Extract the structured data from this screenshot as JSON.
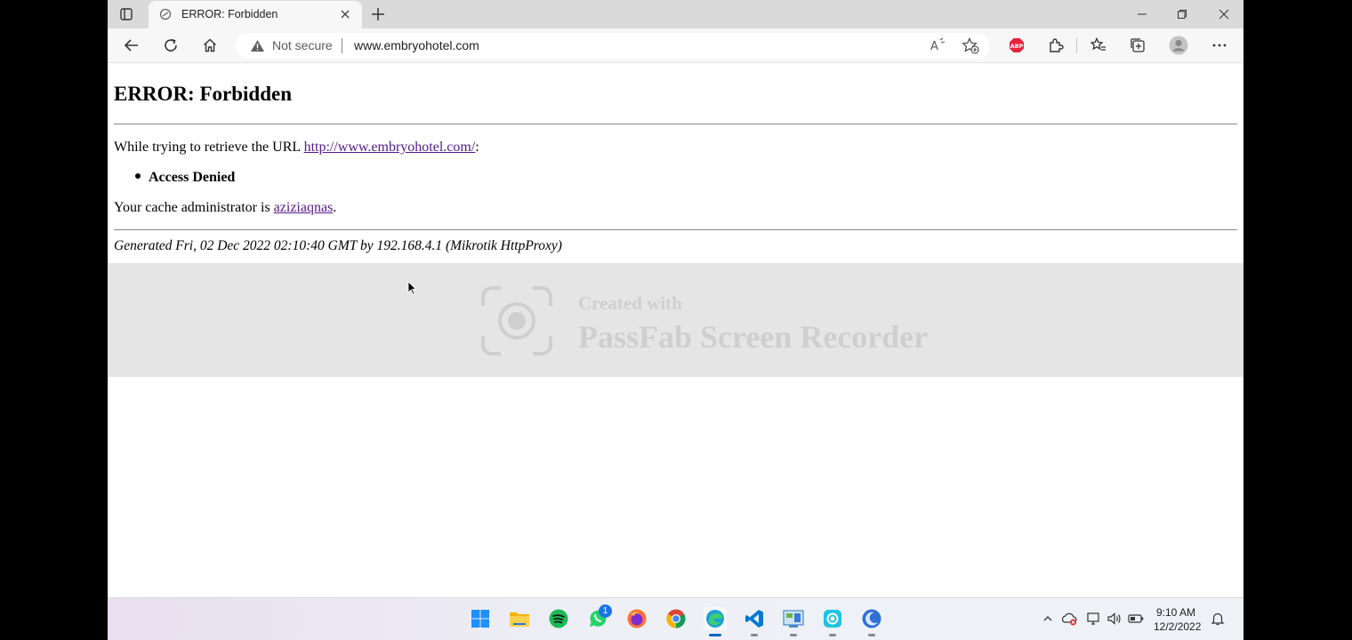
{
  "browser": {
    "tab": {
      "title": "ERROR: Forbidden"
    },
    "address": {
      "security": "Not secure",
      "url": "www.embryohotel.com"
    }
  },
  "page": {
    "heading": "ERROR: Forbidden",
    "line1_prefix": "While trying to retrieve the URL ",
    "line1_link": "http://www.embryohotel.com/",
    "line1_suffix": ":",
    "bullet": "Access Denied",
    "admin_prefix": "Your cache administrator is ",
    "admin_link": "aziziaqnas",
    "admin_suffix": ".",
    "footer": "Generated Fri, 02 Dec 2022 02:10:40 GMT by 192.168.4.1 (Mikrotik HttpProxy)"
  },
  "watermark": {
    "line1": "Created with",
    "line2": "PassFab Screen Recorder"
  },
  "taskbar": {
    "whatsapp_badge": "1",
    "time": "9:10 AM",
    "date": "12/2/2022"
  },
  "colors": {
    "accent": "#0067c0",
    "link": "#551a8b",
    "abp": "#e8233f"
  }
}
